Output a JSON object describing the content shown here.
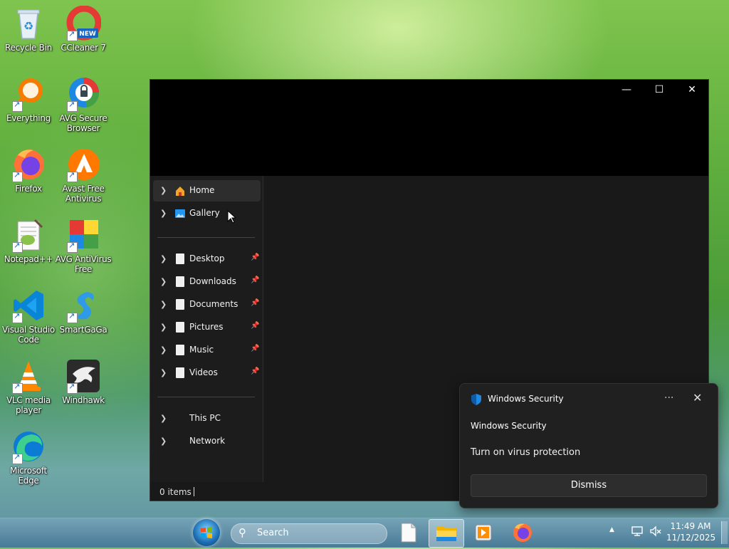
{
  "desktop": {
    "icons": [
      {
        "label": "Recycle Bin",
        "icon": "recycle-bin-icon"
      },
      {
        "label": "CCleaner 7",
        "icon": "ccleaner-icon",
        "badge": "NEW"
      },
      {
        "label": "Everything",
        "icon": "everything-search-icon"
      },
      {
        "label": "AVG Secure Browser",
        "icon": "avg-secure-browser-icon"
      },
      {
        "label": "Firefox",
        "icon": "firefox-icon"
      },
      {
        "label": "Avast Free Antivirus",
        "icon": "avast-icon"
      },
      {
        "label": "Notepad++",
        "icon": "notepad-plus-plus-icon"
      },
      {
        "label": "AVG AntiVirus Free",
        "icon": "avg-antivirus-icon"
      },
      {
        "label": "Visual Studio Code",
        "icon": "vscode-icon"
      },
      {
        "label": "SmartGaGa",
        "icon": "smartgaga-icon"
      },
      {
        "label": "VLC media player",
        "icon": "vlc-icon"
      },
      {
        "label": "Windhawk",
        "icon": "windhawk-icon"
      },
      {
        "label": "Microsoft Edge",
        "icon": "edge-icon"
      }
    ]
  },
  "explorer": {
    "caption": {
      "minimize": "—",
      "maximize": "☐",
      "close": "✕"
    },
    "nav": [
      {
        "label": "Home",
        "icon": "home-icon",
        "pinned": false
      },
      {
        "label": "Gallery",
        "icon": "gallery-icon",
        "pinned": false
      },
      {
        "label": "Desktop",
        "icon": "document-icon",
        "pinned": true
      },
      {
        "label": "Downloads",
        "icon": "document-icon",
        "pinned": true
      },
      {
        "label": "Documents",
        "icon": "document-icon",
        "pinned": true
      },
      {
        "label": "Pictures",
        "icon": "document-icon",
        "pinned": true
      },
      {
        "label": "Music",
        "icon": "document-icon",
        "pinned": true
      },
      {
        "label": "Videos",
        "icon": "document-icon",
        "pinned": true
      },
      {
        "label": "This PC",
        "icon": "",
        "pinned": false
      },
      {
        "label": "Network",
        "icon": "",
        "pinned": false
      }
    ],
    "status": "0 items"
  },
  "notification": {
    "app": "Windows Security",
    "title": "Windows Security",
    "body": "Turn on virus protection",
    "more": "···",
    "close": "✕",
    "button": "Dismiss"
  },
  "taskbar": {
    "search_placeholder": "Search",
    "apps": [
      {
        "name": "notepad",
        "icon": "document-icon",
        "active": false
      },
      {
        "name": "file-explorer",
        "icon": "folder-icon",
        "active": true
      },
      {
        "name": "media-player",
        "icon": "media-player-icon",
        "active": false
      },
      {
        "name": "firefox",
        "icon": "firefox-icon",
        "active": false
      }
    ],
    "tray": {
      "overflow": "▲"
    },
    "clock": {
      "time": "11:49 AM",
      "date": "11/12/2025"
    }
  },
  "colors": {
    "accent": "#0078d4",
    "explorer_bg": "#191919",
    "nav_selected": "#2d2d2d"
  }
}
